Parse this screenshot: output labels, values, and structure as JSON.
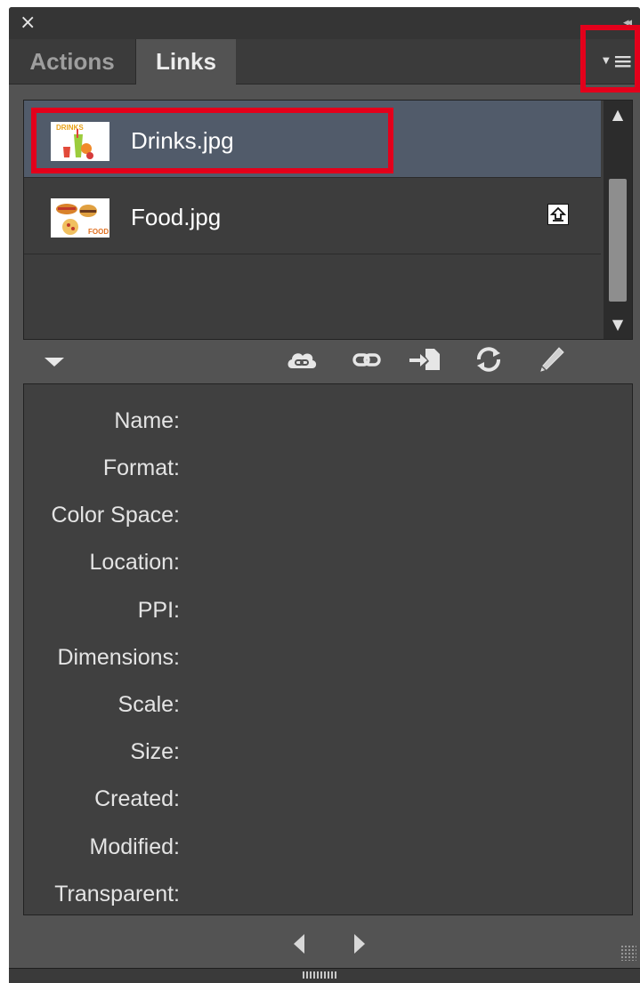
{
  "window": {
    "close_glyph": "×",
    "collapse_glyph": "◂◂"
  },
  "tabs": [
    {
      "label": "Actions",
      "active": false
    },
    {
      "label": "Links",
      "active": true
    }
  ],
  "panel_menu_icon": "panel-menu-icon",
  "links": [
    {
      "name": "Drinks.jpg",
      "selected": true,
      "thumbnail": "drinks-thumbnail",
      "thumb_text": "DRINKS",
      "status": ""
    },
    {
      "name": "Food.jpg",
      "selected": false,
      "thumbnail": "food-thumbnail",
      "thumb_text": "FOOD",
      "status": "modified-link-icon"
    }
  ],
  "toolbar": {
    "icons": [
      "cc-library-link-icon",
      "relink-icon",
      "go-to-link-icon",
      "update-link-icon",
      "edit-original-icon"
    ]
  },
  "info": {
    "labels": [
      "Name:",
      "Format:",
      "Color Space:",
      "Location:",
      "PPI:",
      "Dimensions:",
      "Scale:",
      "Size:",
      "Created:",
      "Modified:",
      "Transparent:"
    ]
  },
  "footer": {
    "prev_icon": "previous-link-icon",
    "next_icon": "next-link-icon"
  },
  "colors": {
    "highlight": "#e3001b",
    "panel_bg": "#535353",
    "selected_row": "#515b6a"
  }
}
